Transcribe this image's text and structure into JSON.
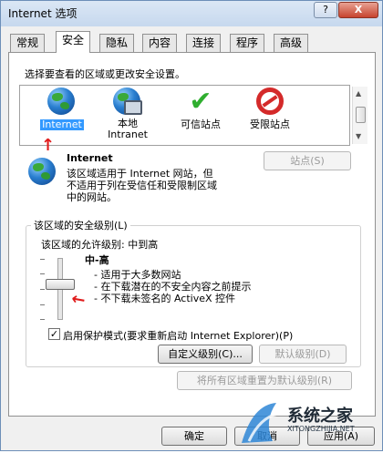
{
  "window": {
    "title": "Internet 选项",
    "help_label": "?",
    "close_label": "X"
  },
  "tabs": [
    {
      "label": "常规",
      "active": false
    },
    {
      "label": "安全",
      "active": true
    },
    {
      "label": "隐私",
      "active": false
    },
    {
      "label": "内容",
      "active": false
    },
    {
      "label": "连接",
      "active": false
    },
    {
      "label": "程序",
      "active": false
    },
    {
      "label": "高级",
      "active": false
    }
  ],
  "security": {
    "instruction": "选择要查看的区域或更改安全设置。",
    "zones": [
      {
        "label": "Internet",
        "icon": "globe-icon",
        "selected": true
      },
      {
        "label": "本地\nIntranet",
        "icon": "intranet-icon",
        "selected": false
      },
      {
        "label": "可信站点",
        "icon": "checkmark-icon",
        "selected": false
      },
      {
        "label": "受限站点",
        "icon": "restricted-icon",
        "selected": false
      }
    ],
    "selected_zone_title": "Internet",
    "selected_zone_desc": "该区域适用于 Internet 网站，但\n不适用于列在受信任和受限制区域\n中的网站。",
    "sites_button": "站点(S)",
    "level_group_title": "该区域的安全级别(L)",
    "allowed_levels": "该区域的允许级别: 中到高",
    "level_name": "中-高",
    "level_bullets": [
      "- 适用于大多数网站",
      "- 在下载潜在的不安全内容之前提示",
      "- 不下载未签名的 ActiveX 控件"
    ],
    "protected_mode_label": "启用保护模式(要求重新启动 Internet Explorer)(P)",
    "protected_mode_checked": "✓",
    "custom_level_button": "自定义级别(C)...",
    "default_level_button": "默认级别(D)",
    "reset_all_button": "将所有区域重置为默认级别(R)"
  },
  "footer": {
    "ok": "确定",
    "cancel": "取消",
    "apply": "应用(A)"
  },
  "watermark": {
    "brand_cn": "系统之家",
    "brand_url": "XITONGZHIJIA.NET"
  },
  "colors": {
    "selection": "#3399ff",
    "accent_red": "#e01b1b"
  }
}
